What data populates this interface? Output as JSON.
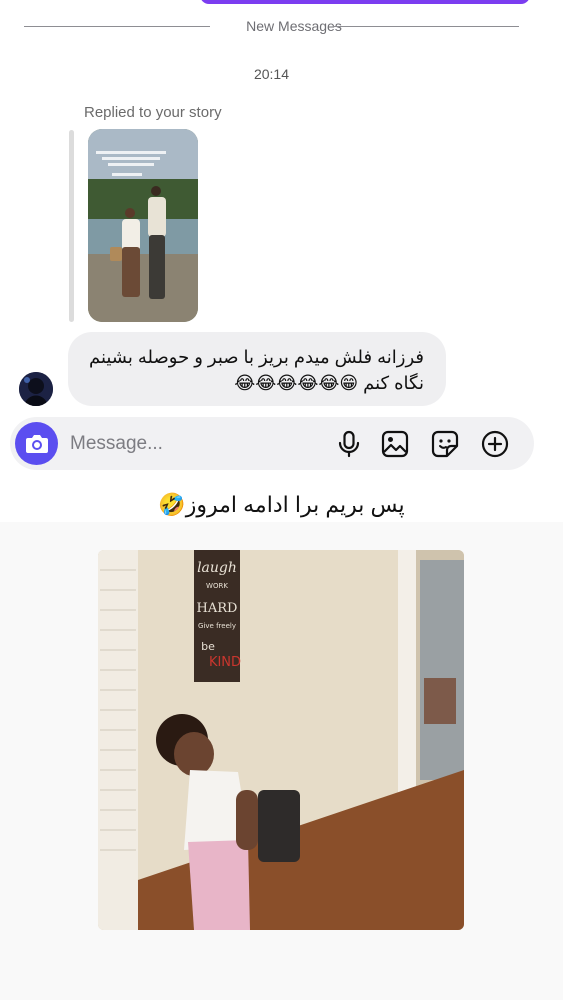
{
  "divider": {
    "label": "New Messages"
  },
  "timestamp": "20:14",
  "story_reply": {
    "label": "Replied to your story"
  },
  "message": {
    "text": "فرزانه فلش میدم بریز با صبر و حوصله بشینم نگاه کنم 😁😂😂😂😂😂"
  },
  "composer": {
    "placeholder": "Message...",
    "icons": [
      "camera-icon",
      "microphone-icon",
      "gallery-icon",
      "sticker-icon",
      "plus-icon"
    ]
  },
  "caption": {
    "text": "پس بریم برا ادامه امروز🤣"
  },
  "photo_sign": {
    "line1": "laugh",
    "line2": "WORK",
    "line3": "HARD",
    "line4": "Give freely",
    "line5": "be",
    "line6": "KIND"
  },
  "colors": {
    "accent": "#5b4ef0",
    "bubble": "#efeff1",
    "top_pill": "#7b3df0"
  }
}
